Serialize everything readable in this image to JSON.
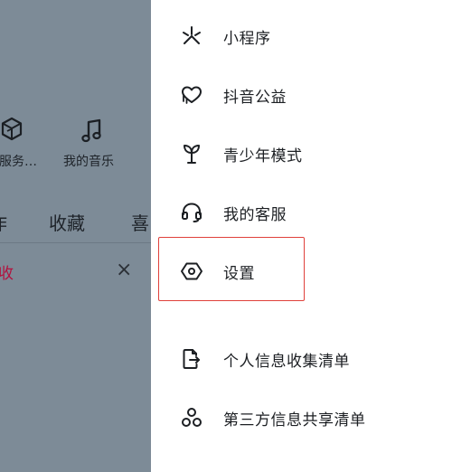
{
  "background": {
    "shortcuts": [
      {
        "label": "服务…",
        "icon": "cube-icon"
      },
      {
        "label": "我的音乐",
        "icon": "music-note-icon"
      }
    ],
    "tabs": [
      "作",
      "收藏",
      "喜"
    ],
    "notice_text": "收",
    "close_symbol": "×"
  },
  "drawer": {
    "menu": [
      {
        "label": "小程序",
        "icon": "mini-program-icon"
      },
      {
        "label": "抖音公益",
        "icon": "charity-heart-icon"
      },
      {
        "label": "青少年模式",
        "icon": "sprout-icon"
      },
      {
        "label": "我的客服",
        "icon": "headset-icon"
      },
      {
        "label": "设置",
        "icon": "settings-hexagon-icon"
      },
      {
        "label": "个人信息收集清单",
        "icon": "document-export-icon"
      },
      {
        "label": "第三方信息共享清单",
        "icon": "share-nodes-icon"
      }
    ],
    "highlight_color": "#e0413b"
  },
  "colors": {
    "overlay": "#7d8b97",
    "notice": "#b3123e"
  }
}
